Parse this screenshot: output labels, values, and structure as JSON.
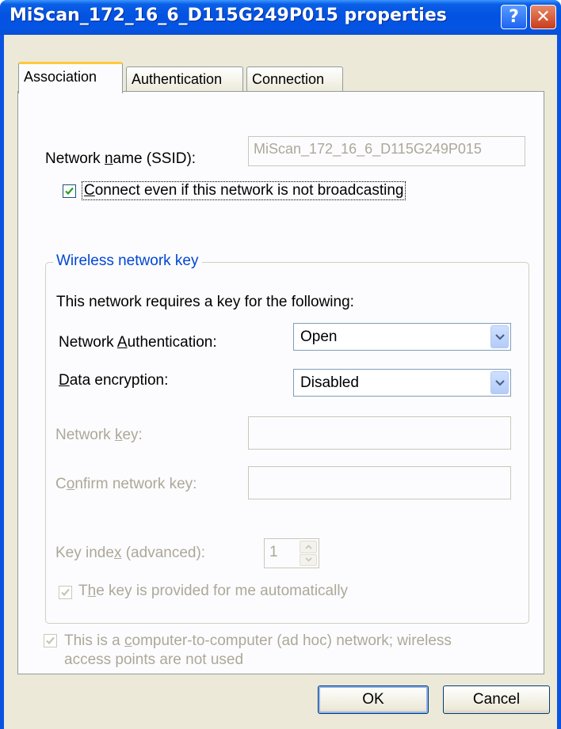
{
  "window": {
    "title": "MiScan_172_16_6_D115G249P015 properties",
    "help_glyph": "?",
    "close_glyph": "✕"
  },
  "tabs": [
    {
      "label": "Association",
      "active": true
    },
    {
      "label": "Authentication",
      "active": false
    },
    {
      "label": "Connection",
      "active": false
    }
  ],
  "association": {
    "ssid_label_pre": "Network ",
    "ssid_label_key": "n",
    "ssid_label_post": "ame (SSID):",
    "ssid_value": "MiScan_172_16_6_D115G249P015",
    "broadcast_checkbox": {
      "key": "C",
      "label": "onnect even if this network is not broadcasting",
      "checked": true
    },
    "wireless_key_group": {
      "legend": "Wireless network key",
      "intro": "This network requires a key for the following:",
      "auth_label_pre": "Network ",
      "auth_label_key": "A",
      "auth_label_post": "uthentication:",
      "auth_value": "Open",
      "enc_label_key": "D",
      "enc_label_post": "ata encryption:",
      "enc_value": "Disabled",
      "netkey_label_pre": "Network ",
      "netkey_label_key": "k",
      "netkey_label_post": "ey:",
      "netkey_value": "",
      "confirm_label_pre": "C",
      "confirm_label_key": "o",
      "confirm_label_post": "nfirm network key:",
      "confirm_value": "",
      "keyindex_label_pre": "Key inde",
      "keyindex_label_key": "x",
      "keyindex_label_post": " (advanced):",
      "keyindex_value": "1",
      "auto_key": {
        "key": "h",
        "pre": "T",
        "label": "e key is provided for me automatically",
        "checked": true
      }
    },
    "adhoc": {
      "pre": "This is a ",
      "key": "c",
      "line1_post": "omputer-to-computer (ad hoc) network; wireless",
      "line2": "access points are not used",
      "checked": true
    }
  },
  "buttons": {
    "ok": "OK",
    "cancel": "Cancel"
  },
  "colors": {
    "titlebar_blue": "#0352e2",
    "dialog_face": "#ece9d8",
    "groupbox_legend": "#0046d5",
    "disabled_text": "#aca899",
    "checkmark_green": "#21a121",
    "tab_active_accent": "#ffc83c"
  }
}
